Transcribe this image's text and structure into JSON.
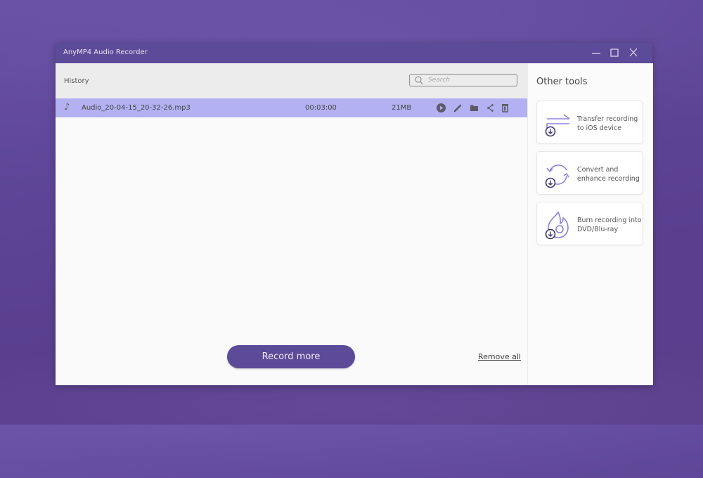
{
  "window": {
    "title": "AnyMP4 Audio Recorder",
    "controls": [
      "minimize",
      "maximize",
      "close"
    ]
  },
  "history": {
    "label": "History",
    "search": {
      "placeholder": "Search",
      "value": ""
    },
    "items": [
      {
        "icon": "music-note-icon",
        "filename": "Audio_20-04-15_20-32-26.mp3",
        "duration": "00:03:00",
        "size": "21MB",
        "actions": [
          "play",
          "edit",
          "open-folder",
          "share",
          "delete"
        ],
        "selected": true
      }
    ]
  },
  "footer": {
    "record_more_label": "Record more",
    "remove_all_label": "Remove all"
  },
  "other_tools": {
    "title": "Other tools",
    "items": [
      {
        "icon": "transfer-icon",
        "label": "Transfer recording to iOS device"
      },
      {
        "icon": "convert-icon",
        "label": "Convert and enhance recording"
      },
      {
        "icon": "burn-disc-icon",
        "label": "Burn recording into DVD/Blu-ray"
      }
    ]
  },
  "colors": {
    "accent": "#5b4b98",
    "selected_row": "#b3b1f1",
    "icon_stroke": "#7b6fd0"
  }
}
